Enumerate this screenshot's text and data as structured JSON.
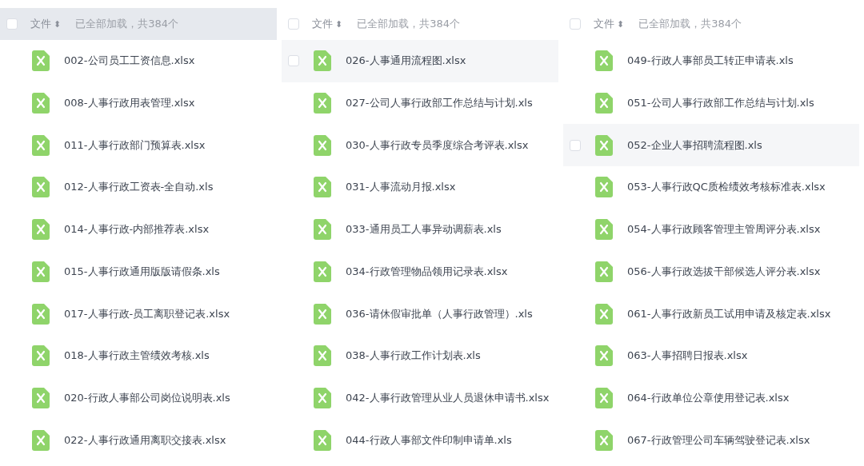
{
  "panels": [
    {
      "header": {
        "checked": false,
        "column": "文件",
        "sort_icon": "⬍",
        "status": "已全部加载，共384个",
        "highlighted": true
      },
      "files": [
        {
          "name": "002-公司员工工资信息.xlsx",
          "highlighted": false
        },
        {
          "name": "008-人事行政用表管理.xlsx",
          "highlighted": false
        },
        {
          "name": "011-人事行政部门预算表.xlsx",
          "highlighted": false
        },
        {
          "name": "012-人事行政工资表-全自动.xls",
          "highlighted": false
        },
        {
          "name": "014-人事行政-内部推荐表.xlsx",
          "highlighted": false
        },
        {
          "name": "015-人事行政通用版版请假条.xls",
          "highlighted": false
        },
        {
          "name": "017-人事行政-员工离职登记表.xlsx",
          "highlighted": false
        },
        {
          "name": "018-人事行政主管绩效考核.xls",
          "highlighted": false
        },
        {
          "name": "020-行政人事部公司岗位说明表.xls",
          "highlighted": false
        },
        {
          "name": "022-人事行政通用离职交接表.xlsx",
          "highlighted": false
        }
      ]
    },
    {
      "header": {
        "checked": false,
        "column": "文件",
        "sort_icon": "⬍",
        "status": "已全部加载，共384个",
        "highlighted": false
      },
      "files": [
        {
          "name": "026-人事通用流程图.xlsx",
          "highlighted": true
        },
        {
          "name": "027-公司人事行政部工作总结与计划.xls",
          "highlighted": false
        },
        {
          "name": "030-人事行政专员季度综合考评表.xlsx",
          "highlighted": false
        },
        {
          "name": "031-人事流动月报.xlsx",
          "highlighted": false
        },
        {
          "name": "033-通用员工人事异动调薪表.xls",
          "highlighted": false
        },
        {
          "name": "034-行政管理物品领用记录表.xlsx",
          "highlighted": false
        },
        {
          "name": "036-请休假审批单（人事行政管理）.xls",
          "highlighted": false
        },
        {
          "name": "038-人事行政工作计划表.xls",
          "highlighted": false
        },
        {
          "name": "042-人事行政管理从业人员退休申请书.xlsx",
          "highlighted": false
        },
        {
          "name": "044-行政人事部文件印制申请单.xls",
          "highlighted": false
        }
      ]
    },
    {
      "header": {
        "checked": false,
        "column": "文件",
        "sort_icon": "⬍",
        "status": "已全部加载，共384个",
        "highlighted": false
      },
      "files": [
        {
          "name": "049-行政人事部员工转正申请表.xls",
          "highlighted": false
        },
        {
          "name": "051-公司人事行政部工作总结与计划.xls",
          "highlighted": false
        },
        {
          "name": "052-企业人事招聘流程图.xls",
          "highlighted": true
        },
        {
          "name": "053-人事行政QC质检绩效考核标准表.xlsx",
          "highlighted": false
        },
        {
          "name": "054-人事行政顾客管理主管周评分表.xlsx",
          "highlighted": false
        },
        {
          "name": "056-人事行政选拔干部候选人评分表.xlsx",
          "highlighted": false
        },
        {
          "name": "061-人事行政新员工试用申请及核定表.xlsx",
          "highlighted": false
        },
        {
          "name": "063-人事招聘日报表.xlsx",
          "highlighted": false
        },
        {
          "name": "064-行政单位公章使用登记表.xlsx",
          "highlighted": false
        },
        {
          "name": "067-行政管理公司车辆驾驶登记表.xlsx",
          "highlighted": false
        }
      ]
    }
  ]
}
